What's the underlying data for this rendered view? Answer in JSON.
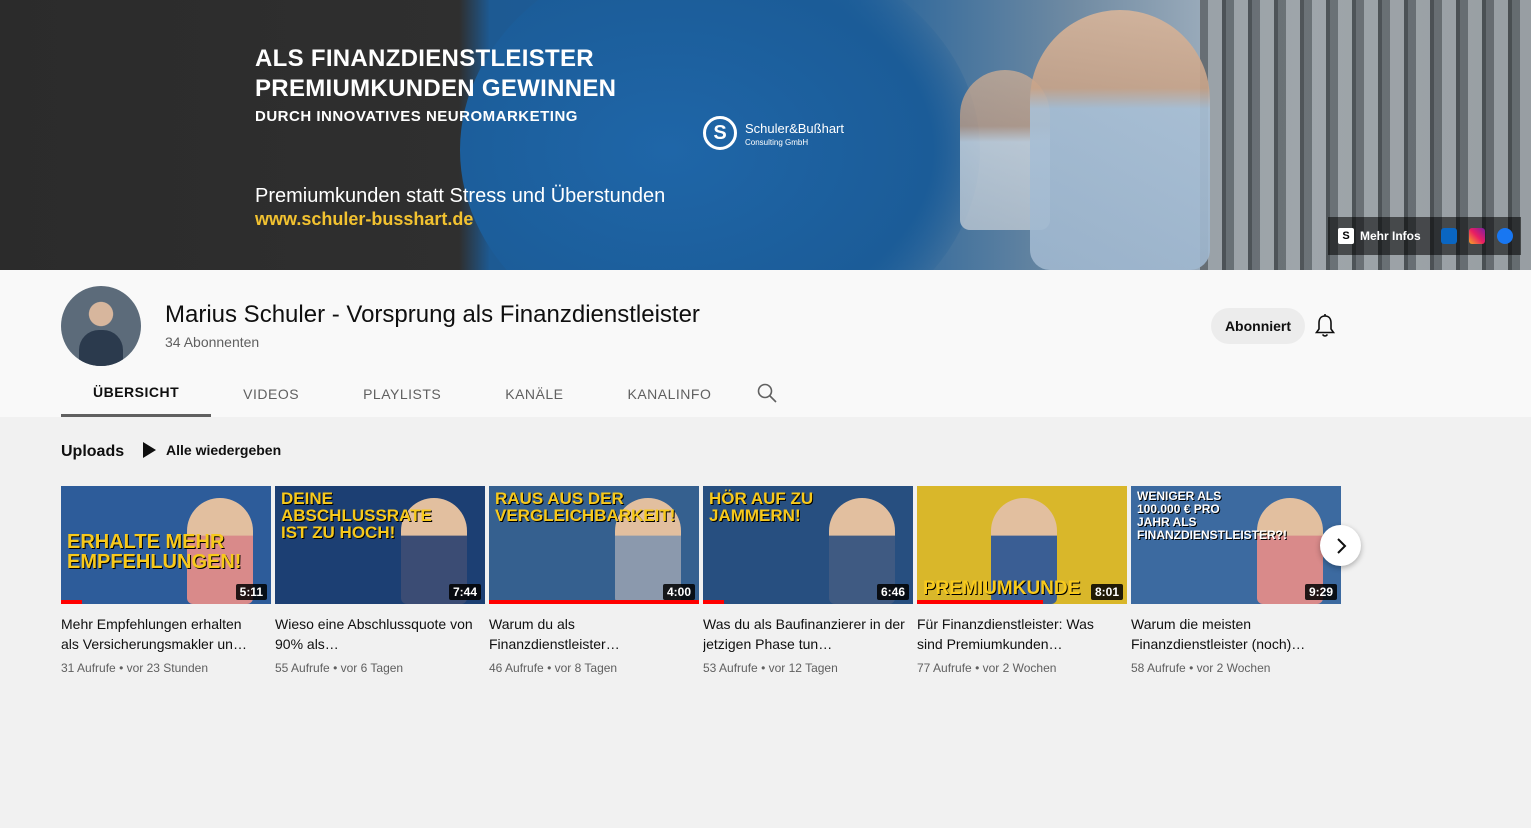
{
  "banner": {
    "line1": "ALS FINANZDIENSTLEISTER",
    "line2": "PREMIUMKUNDEN GEWINNEN",
    "line3": "DURCH INNOVATIVES NEUROMARKETING",
    "line4": "Premiumkunden statt Stress und Überstunden",
    "url": "www.schuler-busshart.de",
    "logo_name": "Schuler&Bußhart",
    "logo_sub": "Consulting GmbH",
    "links_label": "Mehr Infos"
  },
  "channel": {
    "name": "Marius Schuler - Vorsprung als Finanzdienstleister",
    "subscribers": "34 Abonnenten",
    "subscribe_label": "Abonniert"
  },
  "tabs": [
    {
      "label": "ÜBERSICHT",
      "active": true
    },
    {
      "label": "VIDEOS"
    },
    {
      "label": "PLAYLISTS"
    },
    {
      "label": "KANÄLE"
    },
    {
      "label": "KANALINFO"
    }
  ],
  "section": {
    "title": "Uploads",
    "play_all": "Alle wiedergeben"
  },
  "videos": [
    {
      "thumb_text": "ERHALTE MEHR EMPFEHLUNGEN!",
      "duration": "5:11",
      "title": "Mehr Empfehlungen erhalten als Versicherungsmakler un…",
      "views": "31 Aufrufe",
      "age": "vor 23 Stunden",
      "progress": 0.1,
      "bg": "#2d5c9a"
    },
    {
      "thumb_text": "DEINE ABSCHLUSSRATE IST ZU HOCH!",
      "duration": "7:44",
      "title": "Wieso eine Abschlussquote von 90% als…",
      "views": "55 Aufrufe",
      "age": "vor 6 Tagen",
      "progress": 0,
      "bg": "#1c3f73"
    },
    {
      "thumb_text": "RAUS AUS DER VERGLEICHBARKEIT!",
      "duration": "4:00",
      "title": "Warum du als Finanzdienstleister…",
      "views": "46 Aufrufe",
      "age": "vor 8 Tagen",
      "progress": 1.0,
      "bg": "#35608f"
    },
    {
      "thumb_text": "HÖR AUF ZU JAMMERN!",
      "duration": "6:46",
      "title": "Was du als Baufinanzierer in der jetzigen Phase tun…",
      "views": "53 Aufrufe",
      "age": "vor 12 Tagen",
      "progress": 0.1,
      "bg": "#274f80"
    },
    {
      "thumb_text": "PREMIUMKUNDE",
      "duration": "8:01",
      "title": "Für Finanzdienstleister: Was sind Premiumkunden…",
      "views": "77 Aufrufe",
      "age": "vor 2 Wochen",
      "progress": 0.6,
      "bg": "#d9b72a"
    },
    {
      "thumb_text": "WENIGER ALS 100.000 € PRO JAHR ALS FINANZDIENSTLEISTER?!",
      "duration": "9:29",
      "title": "Warum die meisten Finanzdienstleister (noch)…",
      "views": "58 Aufrufe",
      "age": "vor 2 Wochen",
      "progress": 0,
      "bg": "#3c6aa0"
    }
  ],
  "meta_separator": "•"
}
